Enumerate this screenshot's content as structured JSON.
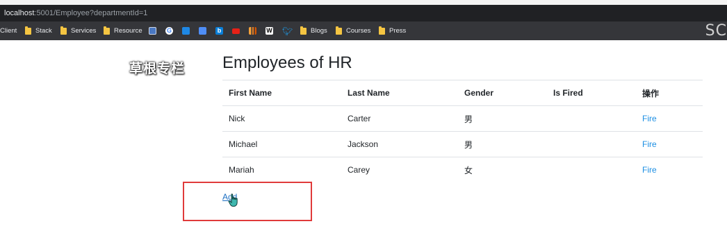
{
  "browser": {
    "url_host": "localhost",
    "url_rest": ":5001/Employee?departmentId=1",
    "bookmarks": [
      "Client",
      "Stack",
      "Services",
      "Resource",
      "Blogs",
      "Courses",
      "Press"
    ],
    "corner_text": "SC"
  },
  "watermark": "草根专栏",
  "page": {
    "title": "Employees of HR",
    "table": {
      "headers": [
        "First Name",
        "Last Name",
        "Gender",
        "Is Fired",
        "操作"
      ],
      "rows": [
        {
          "first": "Nick",
          "last": "Carter",
          "gender": "男",
          "fired": "",
          "action": "Fire"
        },
        {
          "first": "Michael",
          "last": "Jackson",
          "gender": "男",
          "fired": "",
          "action": "Fire"
        },
        {
          "first": "Mariah",
          "last": "Carey",
          "gender": "女",
          "fired": "",
          "action": "Fire"
        }
      ]
    },
    "add_label": "Add"
  },
  "colors": {
    "link": "#1b8ee3",
    "highlight": "#e03a3a",
    "address_bar_bg": "#202124",
    "bookmarks_bg": "#35363a"
  },
  "icons": [
    "folder-icon",
    "google-icon",
    "bing-icon",
    "youtube-icon",
    "wikipedia-icon",
    "twitter-icon",
    "hand-cursor-icon"
  ]
}
